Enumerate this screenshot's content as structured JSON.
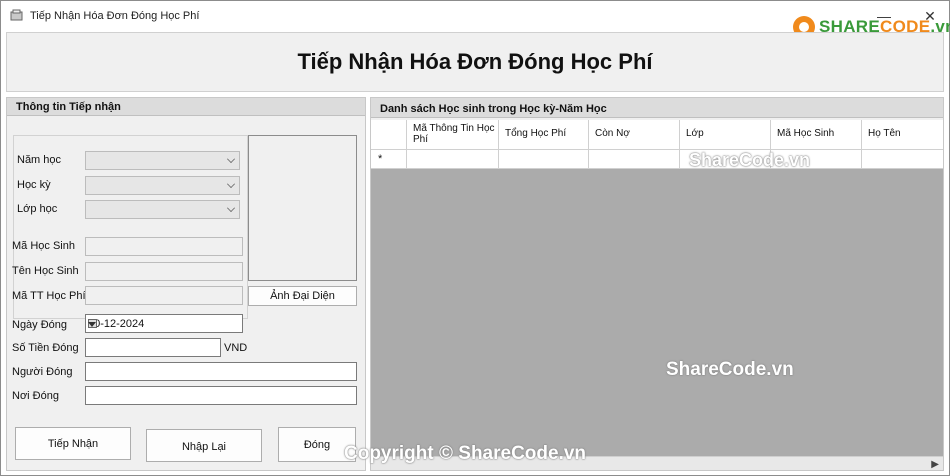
{
  "window": {
    "title": "Tiếp Nhận Hóa Đơn Đóng Học Phí",
    "controls": {
      "minimize": "—",
      "close": "✕"
    }
  },
  "logo": {
    "brand_a": "SHARE",
    "brand_b": "CODE",
    "suffix": ".vn",
    "icon": "sharecode-logo-icon"
  },
  "header": {
    "title": "Tiếp Nhận Hóa Đơn Đóng Học Phí"
  },
  "left_panel": {
    "title": "Thông tin Tiếp nhận",
    "nam_hoc_label": "Năm học",
    "hoc_ky_label": "Học kỳ",
    "lop_hoc_label": "Lớp học",
    "ma_hoc_sinh_label": "Mã Học Sinh",
    "ten_hoc_sinh_label": "Tên Học Sinh",
    "ma_tt_label": "Mã TT Học Phí",
    "ngay_dong_label": "Ngày Đóng",
    "ngay_dong_value": "20-12-2024",
    "so_tien_label": "Số Tiền Đóng",
    "currency": "VND",
    "nguoi_dong_label": "Người Đóng",
    "noi_dong_label": "Nơi Đóng",
    "photo_button": "Ảnh Đại Diện",
    "buttons": {
      "submit": "Tiếp Nhận",
      "reset": "Nhập Lại",
      "close": "Đóng"
    }
  },
  "right_panel": {
    "title": "Danh sách Học sinh trong Học kỳ-Năm Học",
    "columns": [
      "Mã Thông Tin Học Phí",
      "Tổng Học Phí",
      "Còn Nợ",
      "Lớp",
      "Mã Học Sinh",
      "Họ Tên"
    ],
    "new_row_marker": "*"
  },
  "watermarks": {
    "a": "ShareCode.vn",
    "b": "ShareCode.vn",
    "c": "Copyright © ShareCode.vn"
  }
}
